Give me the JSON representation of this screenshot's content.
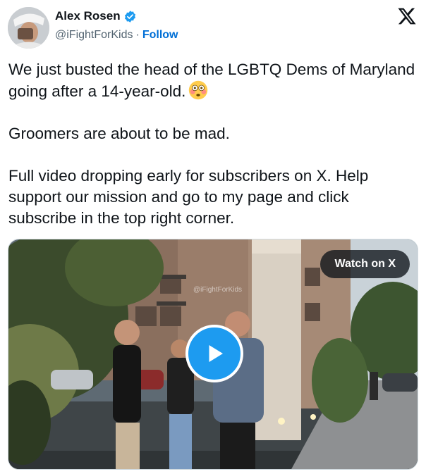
{
  "author": {
    "display_name": "Alex Rosen",
    "handle": "@iFightForKids",
    "separator": "·",
    "follow_label": "Follow"
  },
  "tweet": {
    "paragraph_1": "We just busted the head of the LGBTQ Dems of Maryland going after a 14-year-old.",
    "paragraph_2": "Groomers are about to be mad.",
    "paragraph_3": "Full video dropping early for subscribers on X. Help support our mission and go to my page and click subscribe in the top right corner."
  },
  "media": {
    "watermark": "@iFightForKids",
    "watch_label": "Watch on X"
  },
  "icons": {
    "verified": "verified-badge-icon",
    "logo": "x-logo-icon",
    "emoji": "flushed-face-emoji",
    "play": "play-icon"
  },
  "colors": {
    "accent": "#1d9bf0",
    "follow": "#006fd6",
    "text": "#0f1419",
    "muted": "#536471"
  }
}
